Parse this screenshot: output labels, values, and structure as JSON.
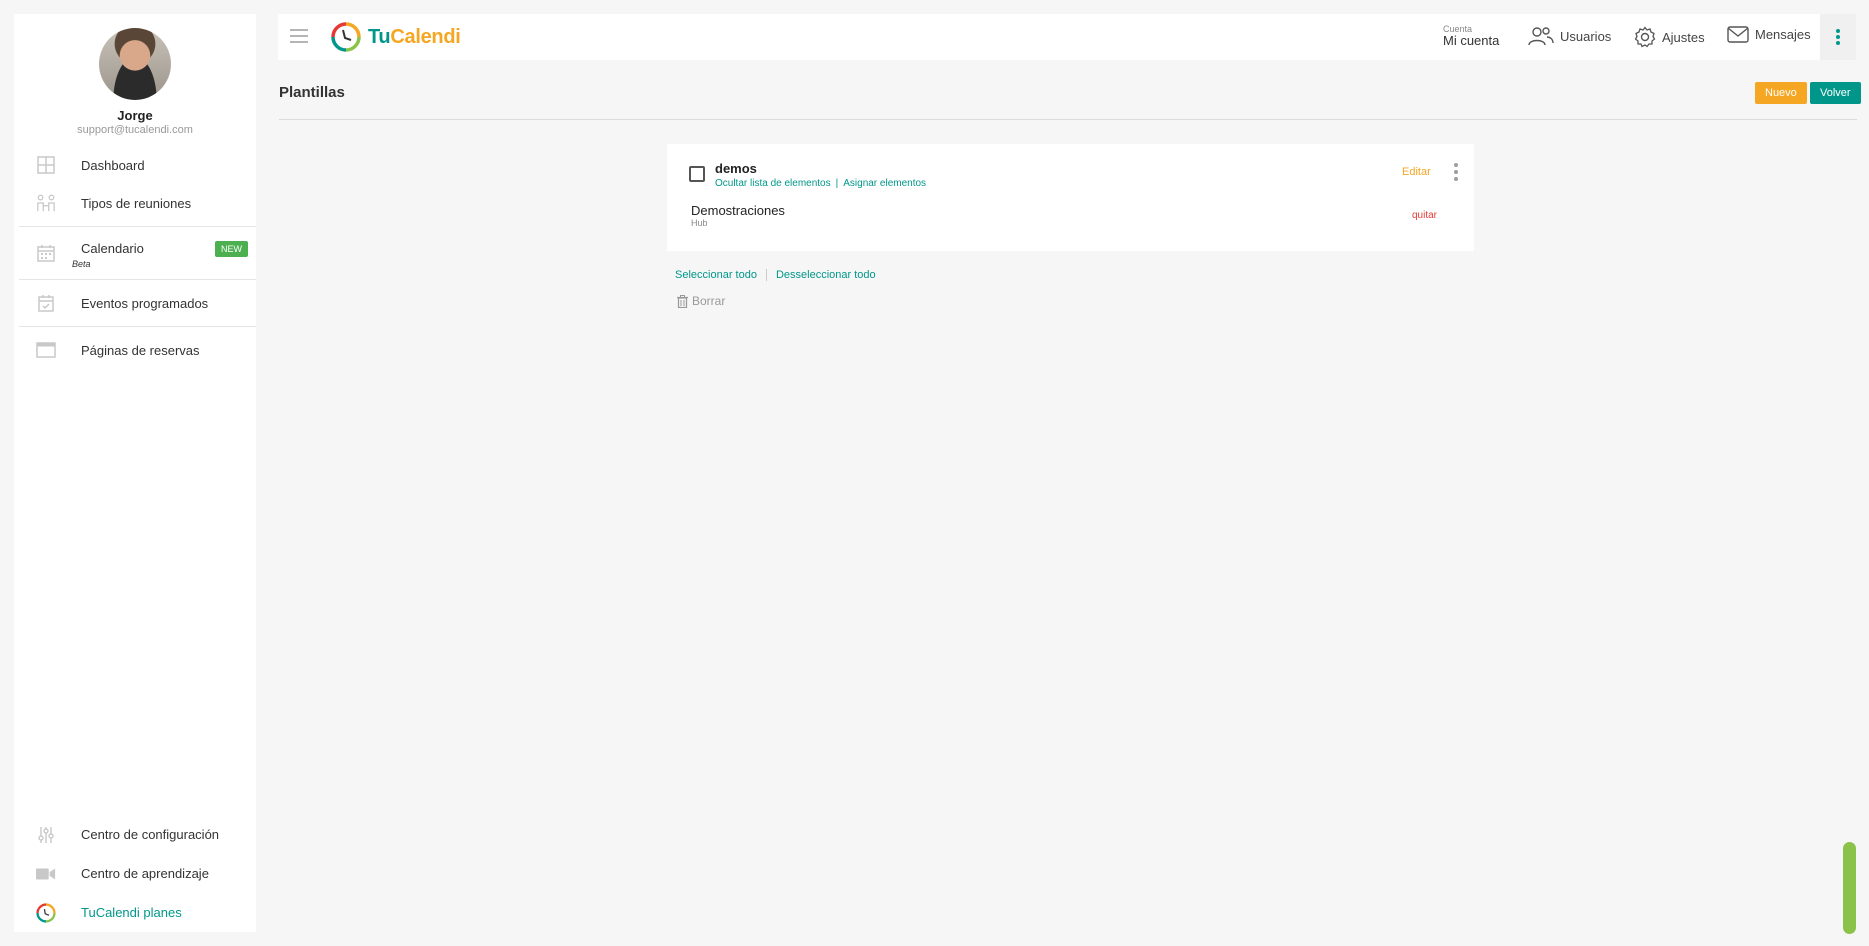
{
  "profile": {
    "name": "Jorge",
    "email": "support@tucalendi.com"
  },
  "sidebar": {
    "items": [
      {
        "label": "Dashboard"
      },
      {
        "label": "Tipos de reuniones"
      },
      {
        "label": "Calendario",
        "sub": "Beta",
        "badge": "NEW"
      },
      {
        "label": "Eventos programados"
      },
      {
        "label": "Páginas de reservas"
      }
    ],
    "bottom": [
      {
        "label": "Centro de configuración"
      },
      {
        "label": "Centro de aprendizaje"
      },
      {
        "label": "TuCalendi planes"
      }
    ]
  },
  "topbar": {
    "logo": {
      "part1": "Tu",
      "part2": "Calend",
      "part3": "i"
    },
    "account_small": "Cuenta",
    "account_big": "Mi cuenta",
    "users": "Usuarios",
    "settings": "Ajustes",
    "messages": "Mensajes"
  },
  "page": {
    "title": "Plantillas",
    "new_button": "Nuevo",
    "back_button": "Volver"
  },
  "template": {
    "name": "demos",
    "hide_list": "Ocultar lista de elementos",
    "separator": "|",
    "assign": "Asignar elementos",
    "edit": "Editar",
    "item_name": "Demostraciones",
    "item_sub": "Hub",
    "remove": "quitar"
  },
  "actions": {
    "select_all": "Seleccionar todo",
    "deselect_all": "Desseleccionar todo",
    "delete": "Borrar"
  },
  "colors": {
    "accent": "#00978a",
    "orange": "#f5a623",
    "green_badge": "#4caf50",
    "danger": "#e53935"
  }
}
